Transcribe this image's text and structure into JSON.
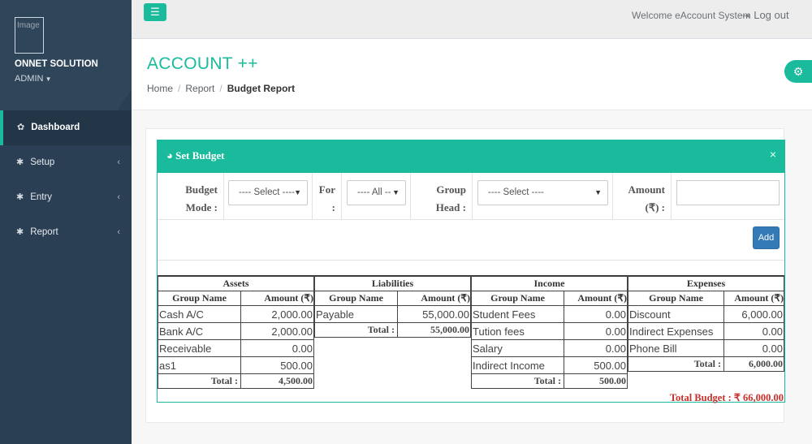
{
  "sidebar": {
    "profile_img_alt": "Image",
    "company": "ONNET SOLUTION",
    "role": "ADMIN",
    "items": [
      {
        "label": "Dashboard"
      },
      {
        "label": "Setup"
      },
      {
        "label": "Entry"
      },
      {
        "label": "Report"
      }
    ]
  },
  "topnav": {
    "welcome": "Welcome eAccount System",
    "logout": "Log out"
  },
  "page": {
    "title": "ACCOUNT ++",
    "breadcrumb": [
      "Home",
      "Report",
      "Budget Report"
    ]
  },
  "panel": {
    "title": "Set Budget",
    "close": "×"
  },
  "form": {
    "budget_mode_label": "Budget Mode :",
    "budget_mode_value": "---- Select ----",
    "for_label": "For :",
    "for_value": "---- All --",
    "group_head_label": "Group Head :",
    "group_head_value": "---- Select ----",
    "amount_label": "Amount (₹) :",
    "amount_value": "",
    "add_label": "Add"
  },
  "budget": {
    "col_group": "Group Name",
    "col_amount": "Amount (₹)",
    "total_label": "Total :",
    "assets": {
      "title": "Assets",
      "rows": [
        {
          "name": "Cash A/C",
          "amount": "2,000.00"
        },
        {
          "name": "Bank A/C",
          "amount": "2,000.00"
        },
        {
          "name": "Receivable",
          "amount": "0.00"
        },
        {
          "name": "as1",
          "amount": "500.00"
        }
      ],
      "total": "4,500.00"
    },
    "liabilities": {
      "title": "Liabilities",
      "rows": [
        {
          "name": "Payable",
          "amount": "55,000.00"
        }
      ],
      "total": "55,000.00"
    },
    "income": {
      "title": "Income",
      "rows": [
        {
          "name": "Student Fees",
          "amount": "0.00"
        },
        {
          "name": "Tution fees",
          "amount": "0.00"
        },
        {
          "name": "Salary",
          "amount": "0.00"
        },
        {
          "name": "Indirect Income",
          "amount": "500.00"
        }
      ],
      "total": "500.00"
    },
    "expenses": {
      "title": "Expenses",
      "rows": [
        {
          "name": "Discount",
          "amount": "6,000.00"
        },
        {
          "name": "Indirect Expenses",
          "amount": "0.00"
        },
        {
          "name": "Phone Bill",
          "amount": "0.00"
        }
      ],
      "total": "6,000.00"
    },
    "total_budget": "Total Budget : ₹ 66,000.00"
  },
  "colors": {
    "accent": "#1abb9c",
    "sidebar": "#2a3f54",
    "button": "#337ab7",
    "total_budget": "#c9302c"
  },
  "icons": {
    "menu": "hamburger-icon",
    "logout": "sign-out-icon",
    "settings": "gear-icon",
    "dashboard": "palette-icon",
    "setup": "cog-icon",
    "entry": "cog-icon",
    "report": "cog-icon",
    "panel": "pie-chart-icon",
    "close": "close-icon"
  }
}
